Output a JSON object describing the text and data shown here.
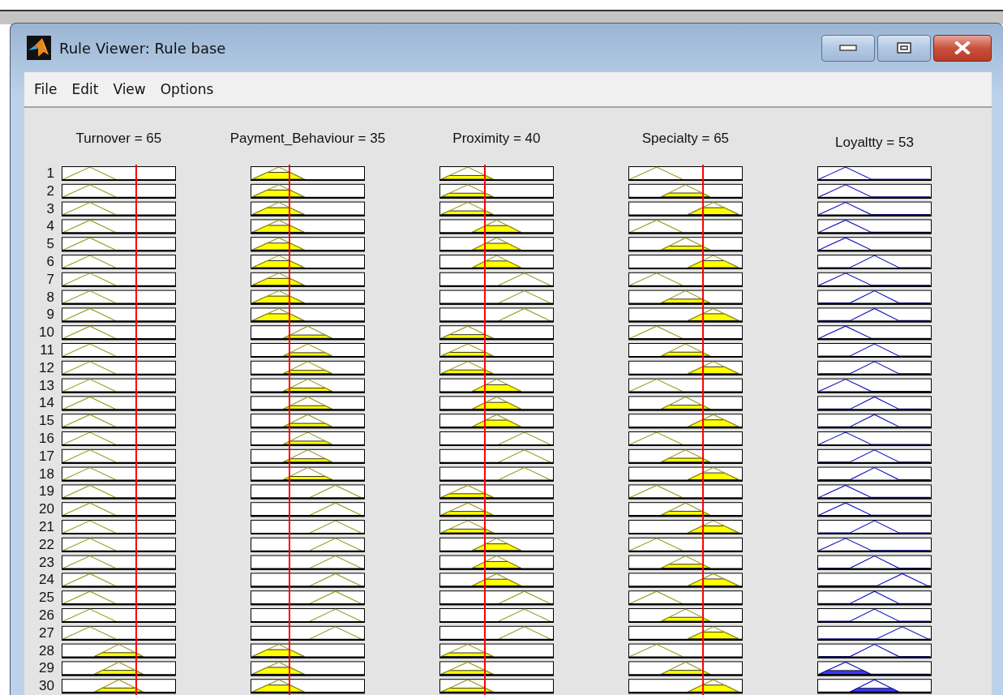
{
  "window": {
    "title": "Rule Viewer: Rule base"
  },
  "menu": [
    {
      "label": "File"
    },
    {
      "label": "Edit"
    },
    {
      "label": "View"
    },
    {
      "label": "Options"
    }
  ],
  "columns": [
    {
      "label": "Turnover = 65",
      "kind": "input"
    },
    {
      "label": "Payment_Behaviour = 35",
      "kind": "input"
    },
    {
      "label": "Proximity = 40",
      "kind": "input"
    },
    {
      "label": "Specialty = 65",
      "kind": "input"
    },
    {
      "label": "Loyaltty = 53",
      "kind": "output"
    }
  ],
  "rows": [
    {
      "number": "1",
      "terms": [
        {
          "kind": "low"
        },
        {
          "kind": "low"
        },
        {
          "kind": "low"
        },
        {
          "kind": "low"
        },
        {
          "kind": "low"
        }
      ]
    },
    {
      "number": "2",
      "terms": [
        {
          "kind": "low"
        },
        {
          "kind": "low"
        },
        {
          "kind": "low"
        },
        {
          "kind": "mid"
        },
        {
          "kind": "low"
        }
      ]
    },
    {
      "number": "3",
      "terms": [
        {
          "kind": "low"
        },
        {
          "kind": "low"
        },
        {
          "kind": "low"
        },
        {
          "kind": "high"
        },
        {
          "kind": "low"
        }
      ]
    },
    {
      "number": "4",
      "terms": [
        {
          "kind": "low"
        },
        {
          "kind": "low"
        },
        {
          "kind": "mid"
        },
        {
          "kind": "low"
        },
        {
          "kind": "low"
        }
      ]
    },
    {
      "number": "5",
      "terms": [
        {
          "kind": "low"
        },
        {
          "kind": "low"
        },
        {
          "kind": "mid"
        },
        {
          "kind": "mid"
        },
        {
          "kind": "low"
        }
      ]
    },
    {
      "number": "6",
      "terms": [
        {
          "kind": "low"
        },
        {
          "kind": "low"
        },
        {
          "kind": "mid"
        },
        {
          "kind": "high"
        },
        {
          "kind": "mid"
        }
      ]
    },
    {
      "number": "7",
      "terms": [
        {
          "kind": "low"
        },
        {
          "kind": "low"
        },
        {
          "kind": "high"
        },
        {
          "kind": "low"
        },
        {
          "kind": "low"
        }
      ]
    },
    {
      "number": "8",
      "terms": [
        {
          "kind": "low"
        },
        {
          "kind": "low"
        },
        {
          "kind": "high"
        },
        {
          "kind": "mid"
        },
        {
          "kind": "mid"
        }
      ]
    },
    {
      "number": "9",
      "terms": [
        {
          "kind": "low"
        },
        {
          "kind": "low"
        },
        {
          "kind": "high"
        },
        {
          "kind": "high"
        },
        {
          "kind": "mid"
        }
      ]
    },
    {
      "number": "10",
      "terms": [
        {
          "kind": "low"
        },
        {
          "kind": "mid"
        },
        {
          "kind": "low"
        },
        {
          "kind": "low"
        },
        {
          "kind": "low"
        }
      ]
    },
    {
      "number": "11",
      "terms": [
        {
          "kind": "low"
        },
        {
          "kind": "mid"
        },
        {
          "kind": "low"
        },
        {
          "kind": "mid"
        },
        {
          "kind": "mid"
        }
      ]
    },
    {
      "number": "12",
      "terms": [
        {
          "kind": "low"
        },
        {
          "kind": "mid"
        },
        {
          "kind": "low"
        },
        {
          "kind": "high"
        },
        {
          "kind": "mid"
        }
      ]
    },
    {
      "number": "13",
      "terms": [
        {
          "kind": "low"
        },
        {
          "kind": "mid"
        },
        {
          "kind": "mid"
        },
        {
          "kind": "low"
        },
        {
          "kind": "low"
        }
      ]
    },
    {
      "number": "14",
      "terms": [
        {
          "kind": "low"
        },
        {
          "kind": "mid"
        },
        {
          "kind": "mid"
        },
        {
          "kind": "mid"
        },
        {
          "kind": "mid"
        }
      ]
    },
    {
      "number": "15",
      "terms": [
        {
          "kind": "low"
        },
        {
          "kind": "mid"
        },
        {
          "kind": "mid"
        },
        {
          "kind": "high"
        },
        {
          "kind": "mid"
        }
      ]
    },
    {
      "number": "16",
      "terms": [
        {
          "kind": "low"
        },
        {
          "kind": "mid"
        },
        {
          "kind": "high"
        },
        {
          "kind": "low"
        },
        {
          "kind": "low"
        }
      ]
    },
    {
      "number": "17",
      "terms": [
        {
          "kind": "low"
        },
        {
          "kind": "mid"
        },
        {
          "kind": "high"
        },
        {
          "kind": "mid"
        },
        {
          "kind": "mid"
        }
      ]
    },
    {
      "number": "18",
      "terms": [
        {
          "kind": "low"
        },
        {
          "kind": "mid"
        },
        {
          "kind": "high"
        },
        {
          "kind": "high"
        },
        {
          "kind": "mid"
        }
      ]
    },
    {
      "number": "19",
      "terms": [
        {
          "kind": "low"
        },
        {
          "kind": "high"
        },
        {
          "kind": "low"
        },
        {
          "kind": "low"
        },
        {
          "kind": "low"
        }
      ]
    },
    {
      "number": "20",
      "terms": [
        {
          "kind": "low"
        },
        {
          "kind": "high"
        },
        {
          "kind": "low"
        },
        {
          "kind": "mid"
        },
        {
          "kind": "low"
        }
      ]
    },
    {
      "number": "21",
      "terms": [
        {
          "kind": "low"
        },
        {
          "kind": "high"
        },
        {
          "kind": "low"
        },
        {
          "kind": "high"
        },
        {
          "kind": "mid"
        }
      ]
    },
    {
      "number": "22",
      "terms": [
        {
          "kind": "low"
        },
        {
          "kind": "high"
        },
        {
          "kind": "mid"
        },
        {
          "kind": "low"
        },
        {
          "kind": "low"
        }
      ]
    },
    {
      "number": "23",
      "terms": [
        {
          "kind": "low"
        },
        {
          "kind": "high"
        },
        {
          "kind": "mid"
        },
        {
          "kind": "mid"
        },
        {
          "kind": "mid"
        }
      ]
    },
    {
      "number": "24",
      "terms": [
        {
          "kind": "low"
        },
        {
          "kind": "high"
        },
        {
          "kind": "mid"
        },
        {
          "kind": "high"
        },
        {
          "kind": "high"
        }
      ]
    },
    {
      "number": "25",
      "terms": [
        {
          "kind": "low"
        },
        {
          "kind": "high"
        },
        {
          "kind": "high"
        },
        {
          "kind": "low"
        },
        {
          "kind": "mid"
        }
      ]
    },
    {
      "number": "26",
      "terms": [
        {
          "kind": "low"
        },
        {
          "kind": "high"
        },
        {
          "kind": "high"
        },
        {
          "kind": "mid"
        },
        {
          "kind": "mid"
        }
      ]
    },
    {
      "number": "27",
      "terms": [
        {
          "kind": "low"
        },
        {
          "kind": "high"
        },
        {
          "kind": "high"
        },
        {
          "kind": "high"
        },
        {
          "kind": "high"
        }
      ]
    },
    {
      "number": "28",
      "terms": [
        {
          "kind": "mid"
        },
        {
          "kind": "low"
        },
        {
          "kind": "low"
        },
        {
          "kind": "low"
        },
        {
          "kind": "mid"
        }
      ]
    },
    {
      "number": "29",
      "terms": [
        {
          "kind": "mid"
        },
        {
          "kind": "low"
        },
        {
          "kind": "low"
        },
        {
          "kind": "mid"
        },
        {
          "kind": "low"
        }
      ]
    },
    {
      "number": "30",
      "terms": [
        {
          "kind": "mid"
        },
        {
          "kind": "low"
        },
        {
          "kind": "low"
        },
        {
          "kind": "high"
        },
        {
          "kind": "mid"
        }
      ]
    }
  ]
}
